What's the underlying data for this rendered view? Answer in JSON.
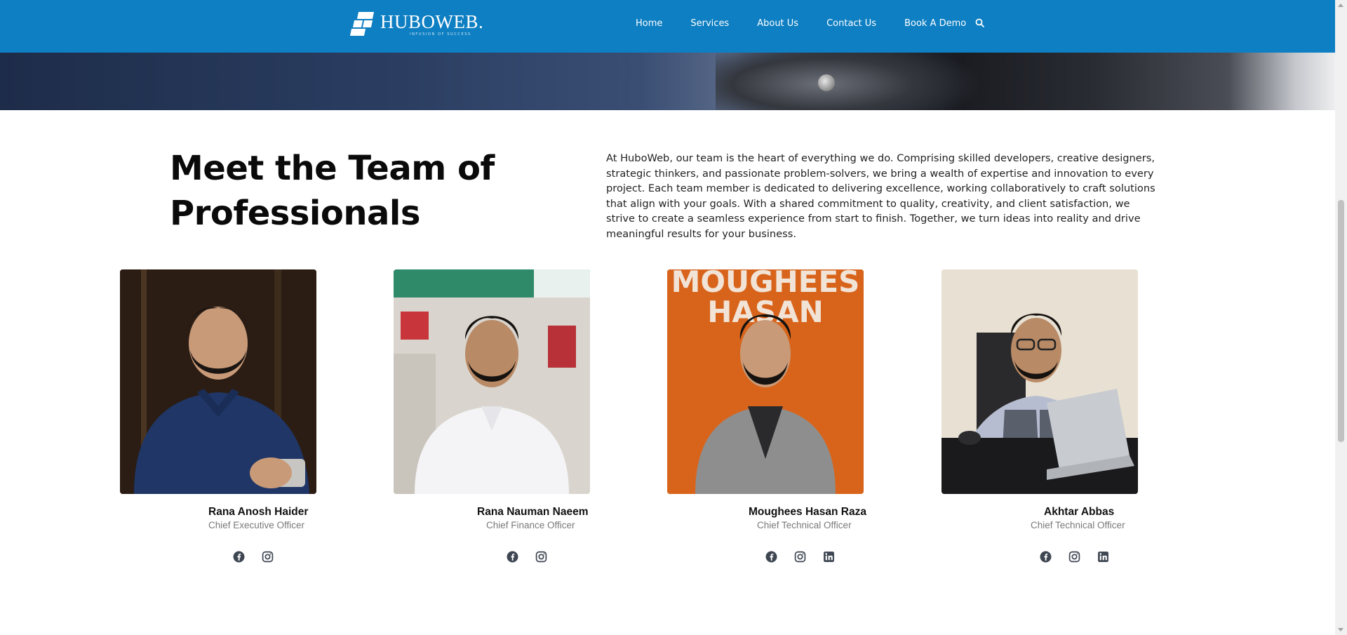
{
  "header": {
    "logo_name": "HUBOWEB.",
    "logo_tagline": "INFUSION OF SUCCESS",
    "nav": [
      {
        "label": "Home"
      },
      {
        "label": "Services"
      },
      {
        "label": "About Us"
      },
      {
        "label": "Contact Us"
      },
      {
        "label": "Book A Demo"
      }
    ],
    "search_icon": "search-icon",
    "brand_color": "#0e7fc2"
  },
  "section": {
    "heading_line1": "Meet the Team of",
    "heading_line2": "Professionals",
    "intro": "At HuboWeb, our team is the heart of everything we do. Comprising skilled developers, creative designers, strategic thinkers, and passionate problem-solvers, we bring a wealth of expertise and innovation to every project. Each team member is dedicated to delivering excellence, working collaboratively to craft solutions that align with your goals. With a shared commitment to quality, creativity, and client satisfaction, we strive to create a seamless experience from start to finish. Together, we turn ideas into reality and drive meaningful results for your business."
  },
  "team": [
    {
      "name": "Rana Anosh Haider",
      "role": "Chief Executive Officer",
      "socials": [
        "facebook-icon",
        "instagram-icon"
      ]
    },
    {
      "name": "Rana Nauman Naeem",
      "role": "Chief Finance Officer",
      "socials": [
        "facebook-icon",
        "instagram-icon"
      ]
    },
    {
      "name": "Moughees Hasan Raza",
      "role": "Chief Technical Officer",
      "poster_text_1": "MOUGHEES",
      "poster_text_2": "HASAN",
      "socials": [
        "facebook-icon",
        "instagram-icon",
        "linkedin-icon"
      ]
    },
    {
      "name": "Akhtar Abbas",
      "role": "Chief Technical Officer",
      "socials": [
        "facebook-icon",
        "instagram-icon",
        "linkedin-icon"
      ]
    }
  ]
}
